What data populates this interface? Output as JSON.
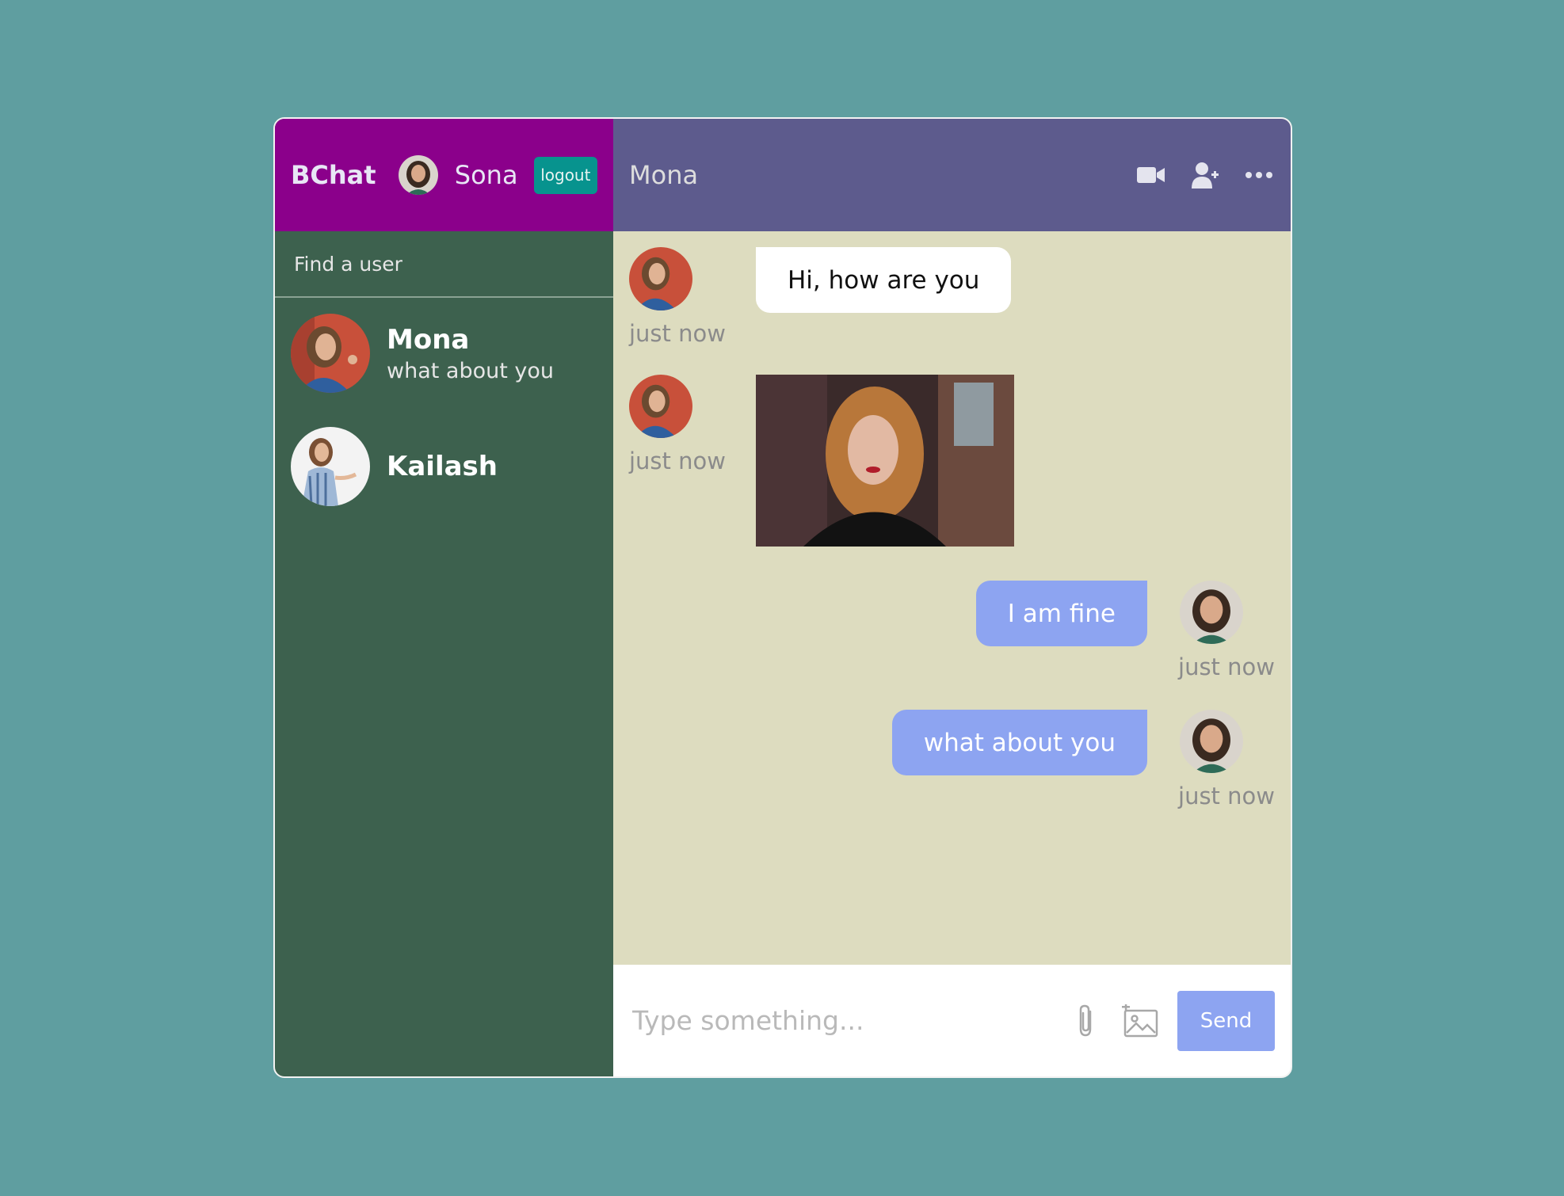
{
  "sidebar": {
    "brand": "BChat",
    "current_user": {
      "name": "Sona"
    },
    "logout_label": "logout",
    "search_placeholder": "Find a user",
    "users": [
      {
        "name": "Mona",
        "last_message": "what about you"
      },
      {
        "name": "Kailash",
        "last_message": ""
      }
    ]
  },
  "chat": {
    "title": "Mona",
    "header_icons": [
      "video-camera-icon",
      "add-user-icon",
      "more-icon"
    ],
    "messages": [
      {
        "from": "Mona",
        "type": "text",
        "text": "Hi, how are you",
        "time": "just now",
        "owner": false
      },
      {
        "from": "Mona",
        "type": "image",
        "time": "just now",
        "owner": false
      },
      {
        "from": "Sona",
        "type": "text",
        "text": "I am fine",
        "time": "just now",
        "owner": true
      },
      {
        "from": "Sona",
        "type": "text",
        "text": "what about you",
        "time": "just now",
        "owner": true
      }
    ],
    "input_placeholder": "Type something...",
    "send_label": "Send"
  },
  "colors": {
    "page_background": "#5f9ea0",
    "sidebar_header": "#8b008b",
    "sidebar": "#3d614e",
    "chat_header": "#5d5b8d",
    "chat_background": "#dddcbf",
    "outgoing_bubble": "#8da4f1",
    "logout_button": "#07938e"
  }
}
